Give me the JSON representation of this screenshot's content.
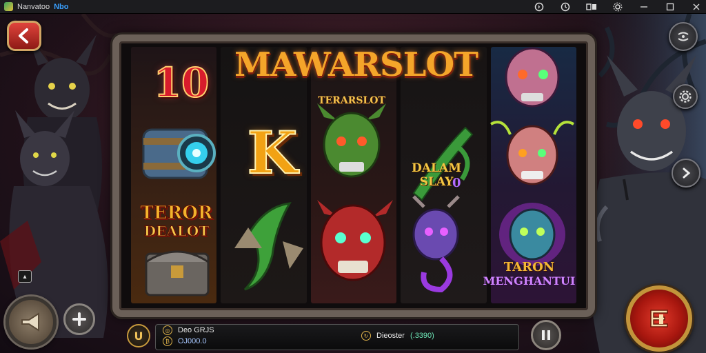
{
  "window": {
    "app_name": "Nanvatoo",
    "app_badge": "Nbo",
    "controls": [
      "recorder-icon",
      "clock-icon",
      "gamepad-icon",
      "settings-icon",
      "minimize-icon",
      "maximize-icon",
      "close-icon"
    ]
  },
  "game": {
    "logo": "MAWARSLOT",
    "logo_sub": "TERARSLOT",
    "symbols": {
      "ten": "10",
      "k": "K",
      "teror_line1": "TEROR",
      "teror_line2": "DEALOT",
      "dalam": "DALAM SLAY",
      "num": "0",
      "teron_line1": "TARON",
      "teron_line2": "MENGHANTUI"
    }
  },
  "bottom_bar": {
    "row1_label": "Deo GRJS",
    "row2_value": "OJ000.0",
    "right_label": "Dieoster",
    "right_value": "(.3390)",
    "coin_symbol": "U"
  },
  "colors": {
    "accent_gold": "#c2943b",
    "spin_red": "#e23a2a",
    "logo_orange": "#f4a52a"
  }
}
